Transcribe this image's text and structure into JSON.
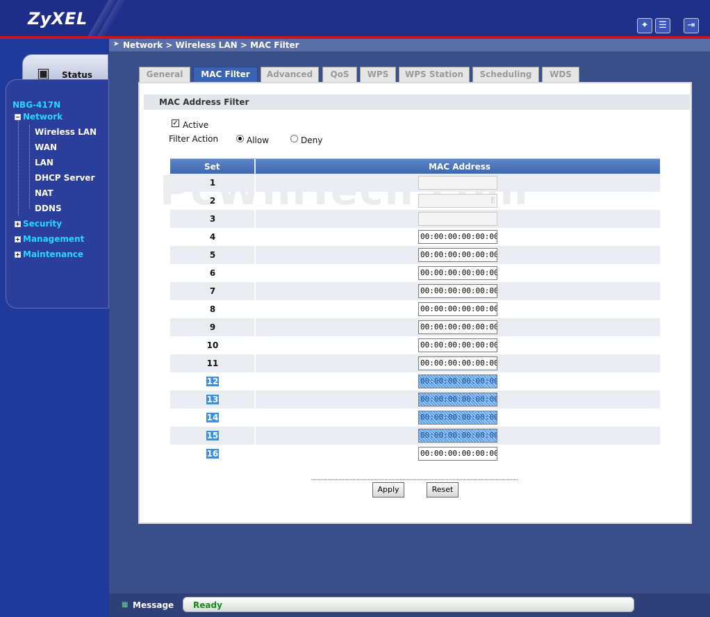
{
  "brand": {
    "logo_text": "ZyXEL"
  },
  "header_icons": [
    {
      "name": "wizard-icon",
      "glyph": "✦"
    },
    {
      "name": "notes-icon",
      "glyph": "☰"
    },
    {
      "name": "logout-icon",
      "glyph": "⇥"
    }
  ],
  "breadcrumb": "Network > Wireless LAN > MAC Filter",
  "sidebar": {
    "status_label": "Status",
    "device": "NBG-417N",
    "items": [
      {
        "label": "Network",
        "level": 0,
        "expander": "−"
      },
      {
        "label": "Wireless LAN",
        "level": 1
      },
      {
        "label": "WAN",
        "level": 1
      },
      {
        "label": "LAN",
        "level": 1
      },
      {
        "label": "DHCP Server",
        "level": 1
      },
      {
        "label": "NAT",
        "level": 1
      },
      {
        "label": "DDNS",
        "level": 1
      },
      {
        "label": "Security",
        "level": 0,
        "expander": "+"
      },
      {
        "label": "Management",
        "level": 0,
        "expander": "+"
      },
      {
        "label": "Maintenance",
        "level": 0,
        "expander": "+"
      }
    ]
  },
  "tabs": [
    {
      "label": "General",
      "active": false
    },
    {
      "label": "MAC Filter",
      "active": true
    },
    {
      "label": "Advanced",
      "active": false
    },
    {
      "label": "QoS",
      "active": false
    },
    {
      "label": "WPS",
      "active": false
    },
    {
      "label": "WPS Station",
      "active": false
    },
    {
      "label": "Scheduling",
      "active": false
    },
    {
      "label": "WDS",
      "active": false
    }
  ],
  "panel": {
    "title": "MAC Address Filter",
    "active_label": "Active",
    "active_checked": true,
    "filter_action_label": "Filter Action",
    "allow_label": "Allow",
    "deny_label": "Deny",
    "filter_action": "Allow"
  },
  "table": {
    "headers": {
      "set": "Set",
      "mac": "MAC Address"
    },
    "rows": [
      {
        "set": "1",
        "mac": "",
        "state": "blur"
      },
      {
        "set": "2",
        "mac": "E",
        "state": "blur"
      },
      {
        "set": "3",
        "mac": "",
        "state": "blur"
      },
      {
        "set": "4",
        "mac": "00:00:00:00:00:00",
        "state": "normal"
      },
      {
        "set": "5",
        "mac": "00:00:00:00:00:00",
        "state": "normal"
      },
      {
        "set": "6",
        "mac": "00:00:00:00:00:00",
        "state": "normal"
      },
      {
        "set": "7",
        "mac": "00:00:00:00:00:00",
        "state": "normal"
      },
      {
        "set": "8",
        "mac": "00:00:00:00:00:00",
        "state": "normal"
      },
      {
        "set": "9",
        "mac": "00:00:00:00:00:00",
        "state": "normal"
      },
      {
        "set": "10",
        "mac": "00:00:00:00:00:00",
        "state": "normal"
      },
      {
        "set": "11",
        "mac": "00:00:00:00:00:00",
        "state": "normal"
      },
      {
        "set": "12",
        "mac": "00:00:00:00:00:00",
        "state": "selected"
      },
      {
        "set": "13",
        "mac": "00:00:00:00:00:00",
        "state": "selected"
      },
      {
        "set": "14",
        "mac": "00:00:00:00:00:00",
        "state": "selected"
      },
      {
        "set": "15",
        "mac": "00:00:00:00:00:00",
        "state": "selected"
      },
      {
        "set": "16",
        "mac": "00:00:00:00:00:00",
        "state": "selected-label"
      }
    ]
  },
  "buttons": {
    "apply": "Apply",
    "reset": "Reset"
  },
  "watermark": "PcWinTech.com",
  "statusbar": {
    "label": "Message",
    "text": "Ready"
  },
  "colors": {
    "accent": "#3b63b4",
    "status_ok": "#118a18",
    "nav_top": "#29d7ff"
  }
}
